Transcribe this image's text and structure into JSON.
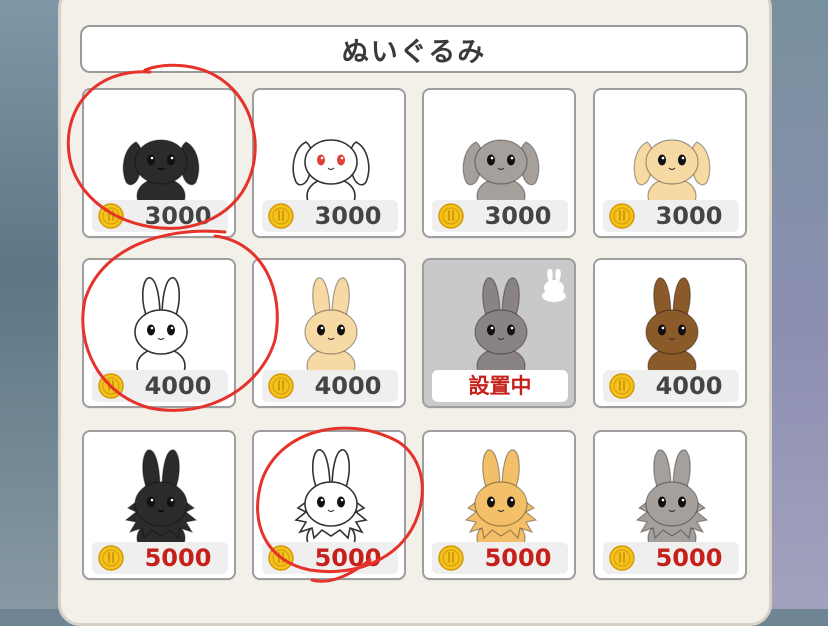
{
  "header": {
    "title": "ぬいぐるみ"
  },
  "items": [
    {
      "price": "3000",
      "style": "lop",
      "fur": "#2b2b2b",
      "eye": "#111111",
      "price_color": "gray"
    },
    {
      "price": "3000",
      "style": "lop",
      "fur": "#ffffff",
      "eye": "#e0403a",
      "price_color": "gray"
    },
    {
      "price": "3000",
      "style": "lop",
      "fur": "#a6a09d",
      "eye": "#111111",
      "price_color": "gray"
    },
    {
      "price": "3000",
      "style": "lop",
      "fur": "#f7d9a4",
      "eye": "#111111",
      "price_color": "gray"
    },
    {
      "price": "4000",
      "style": "erect",
      "fur": "#ffffff",
      "eye": "#111111",
      "price_color": "gray"
    },
    {
      "price": "4000",
      "style": "erect",
      "fur": "#f7d9a4",
      "eye": "#111111",
      "price_color": "gray"
    },
    {
      "price": "",
      "status": "設置中",
      "style": "erect",
      "fur": "#8a8383",
      "eye": "#111111",
      "placed": true
    },
    {
      "price": "4000",
      "style": "erect",
      "fur": "#8a5a2b",
      "eye": "#111111",
      "price_color": "gray"
    },
    {
      "price": "5000",
      "style": "fluffy",
      "fur": "#2b2b2b",
      "eye": "#111111",
      "price_color": "red"
    },
    {
      "price": "5000",
      "style": "fluffy",
      "fur": "#ffffff",
      "eye": "#111111",
      "price_color": "red"
    },
    {
      "price": "5000",
      "style": "fluffy",
      "fur": "#f3c069",
      "eye": "#111111",
      "price_color": "red"
    },
    {
      "price": "5000",
      "style": "fluffy",
      "fur": "#a6a09d",
      "eye": "#111111",
      "price_color": "red"
    }
  ],
  "colors": {
    "coin": "#f4c21a",
    "coin_edge": "#d39a0a",
    "price_red": "#c5211a",
    "annotation": "#e5322a"
  }
}
